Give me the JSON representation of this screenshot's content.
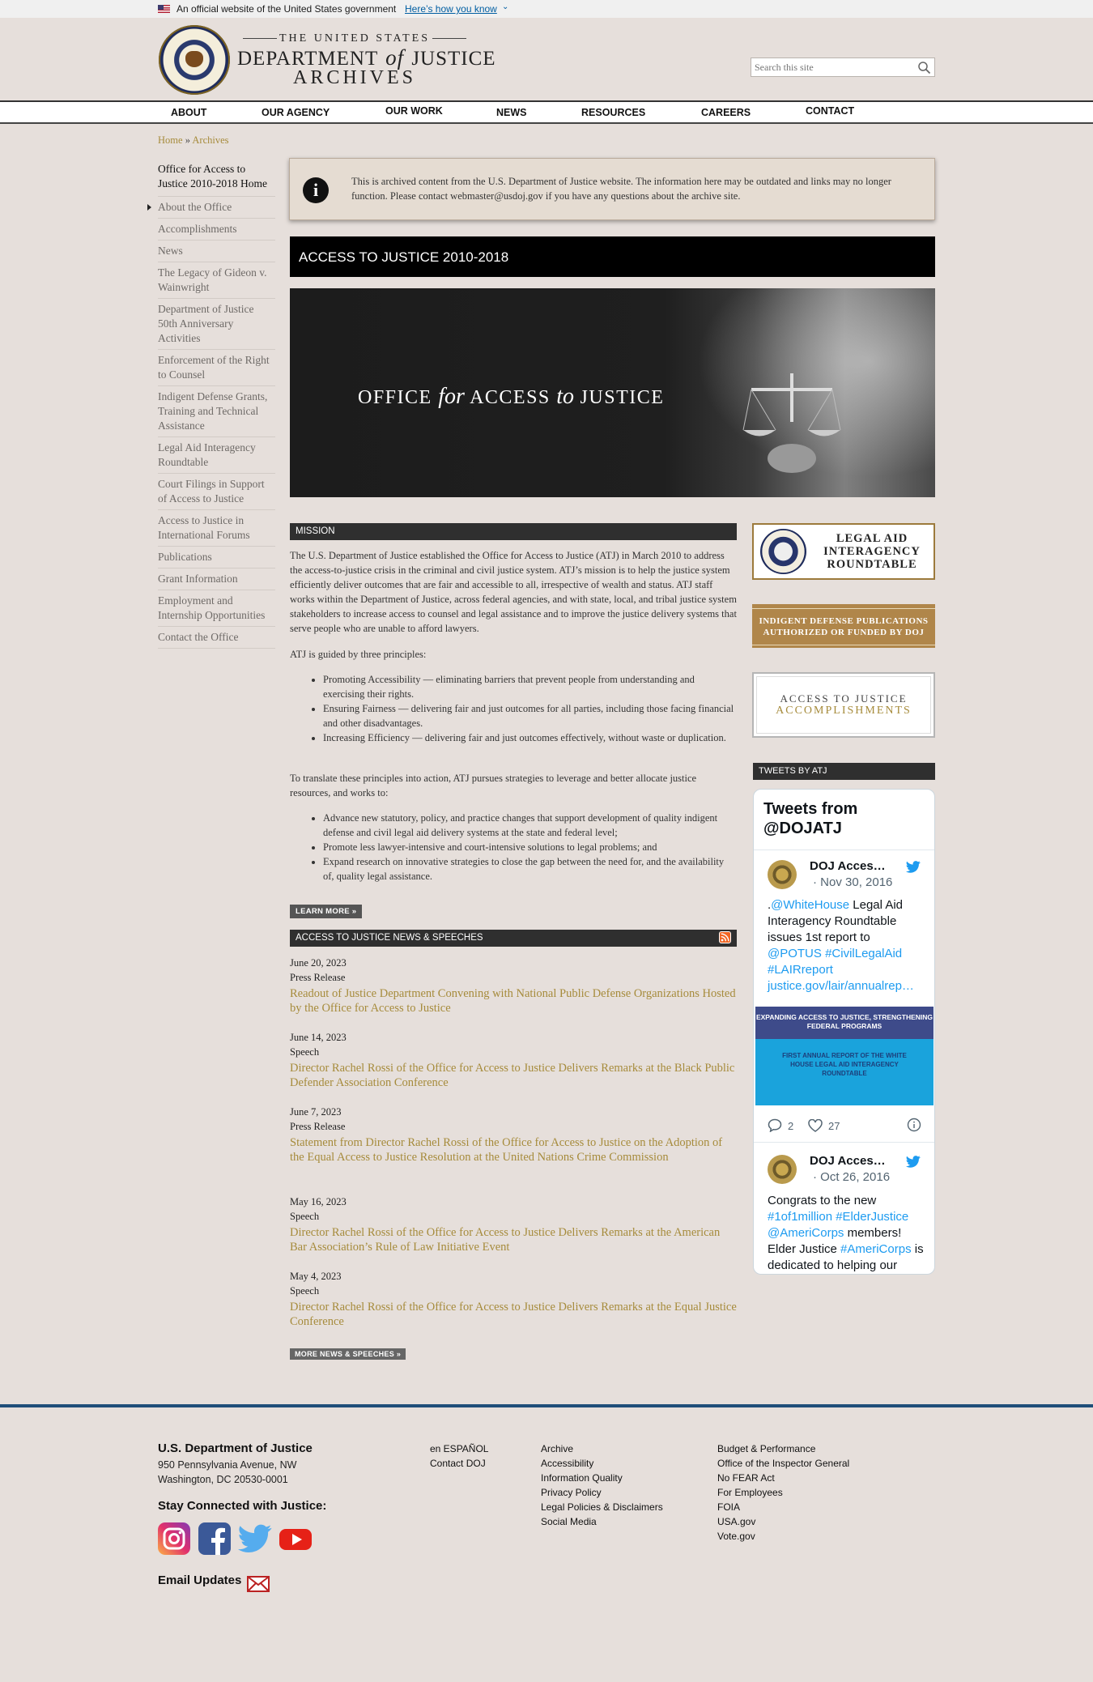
{
  "gov_banner": {
    "text": "An official website of the United States government",
    "link": "Here’s how you know"
  },
  "logo": {
    "top": "THE UNITED STATES",
    "mid_a": "DEPARTMENT",
    "mid_of": "of",
    "mid_b": "JUSTICE",
    "bottom": "ARCHIVES"
  },
  "search": {
    "placeholder": "Search this site"
  },
  "nav": [
    "ABOUT",
    "OUR AGENCY",
    "OUR WORK",
    "NEWS",
    "RESOURCES",
    "CAREERS",
    "CONTACT"
  ],
  "breadcrumb": {
    "home": "Home",
    "sep": "»",
    "current": "Archives"
  },
  "sidebar": {
    "home": "Office for Access to Justice 2010-2018 Home",
    "items": [
      "About the Office",
      "Accomplishments",
      "News",
      "The Legacy of Gideon v. Wainwright",
      "Department of Justice 50th Anniversary Activities",
      "Enforcement of the Right to Counsel",
      "Indigent Defense Grants, Training and Technical Assistance",
      "Legal Aid Interagency Roundtable",
      "Court Filings in Support of Access to Justice",
      "Access to Justice in International Forums",
      "Publications",
      "Grant Information",
      "Employment and Internship Opportunities",
      "Contact the Office"
    ]
  },
  "notice": {
    "text": "This is archived content from the U.S. Department of Justice website. The information here may be outdated and links may no longer function. Please contact webmaster@usdoj.gov if you have any questions about the archive site."
  },
  "page_title": "ACCESS TO JUSTICE 2010-2018",
  "hero": {
    "a": "OFFICE",
    "for": "for",
    "b": "ACCESS",
    "to": "to",
    "c": "JUSTICE"
  },
  "mission": {
    "heading": "MISSION",
    "p1": "The U.S. Department of Justice established the Office for Access to Justice (ATJ) in March 2010 to address the access-to-justice crisis in the criminal and civil justice system. ATJ’s mission is to help the justice system efficiently deliver outcomes that are fair and accessible to all, irrespective of wealth and status. ATJ staff works within the Department of Justice, across federal agencies, and with state, local, and tribal justice system stakeholders to increase access to counsel and legal assistance and to improve the justice delivery systems that serve people who are unable to afford lawyers.",
    "p2": "ATJ is guided by three principles:",
    "principles": [
      "Promoting Accessibility — eliminating barriers that prevent people from understanding and exercising their rights.",
      "Ensuring Fairness — delivering fair and just outcomes for all parties, including those facing financial and other disadvantages.",
      "Increasing Efficiency — delivering fair and just outcomes effectively, without waste or duplication."
    ],
    "p3": "To translate these principles into action, ATJ pursues strategies to leverage and better allocate justice resources, and works to:",
    "works": [
      "Advance new statutory, policy, and practice changes that support development of quality indigent defense and civil legal aid delivery systems at the state and federal level;",
      "Promote less lawyer-intensive and court-intensive solutions to legal problems; and",
      "Expand research on innovative strategies to close the gap between the need for, and the availability of, quality legal assistance."
    ],
    "learn_more": "LEARN MORE »"
  },
  "news": {
    "heading": "ACCESS TO JUSTICE NEWS & SPEECHES",
    "items": [
      {
        "date": "June 20, 2023",
        "type": "Press Release",
        "title": "Readout of Justice Department Convening with National Public Defense Organizations Hosted by the Office for Access to Justice"
      },
      {
        "date": "June 14, 2023",
        "type": "Speech",
        "title": "Director Rachel Rossi of the Office for Access to Justice Delivers Remarks at the Black Public Defender Association Conference"
      },
      {
        "date": "June 7, 2023",
        "type": "Press Release",
        "title": "Statement from Director Rachel Rossi of the Office for Access to Justice on the Adoption of the Equal Access to Justice Resolution at the United Nations Crime Commission"
      },
      {
        "date": "May 16, 2023",
        "type": "Speech",
        "title": "Director Rachel Rossi of the Office for Access to Justice Delivers Remarks at the American Bar Association’s Rule of Law Initiative Event"
      },
      {
        "date": "May 4, 2023",
        "type": "Speech",
        "title": "Director Rachel Rossi of the Office for Access to Justice Delivers Remarks at the Equal Justice Conference"
      }
    ],
    "more": "MORE NEWS & SPEECHES »"
  },
  "promos": {
    "lair": "LEGAL AID INTERAGENCY ROUNDTABLE",
    "indigent": "INDIGENT DEFENSE PUBLICATIONS AUTHORIZED OR FUNDED BY DOJ",
    "accomp_1": "ACCESS TO JUSTICE",
    "accomp_2": "ACCOMPLISHMENTS"
  },
  "tweets": {
    "heading": "TWEETS BY ATJ",
    "title": "Tweets from @DOJATJ",
    "items": [
      {
        "name": "DOJ Acces…",
        "date": "· Nov 30, 2016",
        "pre": ".",
        "l1": "@WhiteHouse",
        "t1": " Legal Aid Interagency Roundtable issues 1st report to ",
        "l2": "@POTUS #CivilLegalAid #LAIRreport justice.gov/lair/annualrep…",
        "media_top": "EXPANDING ACCESS TO JUSTICE, STRENGTHENING FEDERAL PROGRAMS",
        "media_sub": "FIRST ANNUAL REPORT OF THE WHITE HOUSE LEGAL AID INTERAGENCY ROUNDTABLE",
        "replies": "2",
        "likes": "27"
      },
      {
        "name": "DOJ Acces…",
        "date": "· Oct 26, 2016",
        "t1": "Congrats to the new ",
        "l1": "#1of1million #ElderJustice @AmeriCorps",
        "t2": " members! Elder Justice ",
        "l2": "#AmeriCorps",
        "t3": " is dedicated to helping our"
      }
    ]
  },
  "footer": {
    "org": "U.S. Department of Justice",
    "addr1": "950 Pennsylvania Avenue, NW",
    "addr2": "Washington, DC 20530-0001",
    "stay": "Stay Connected with Justice:",
    "email": "Email Updates",
    "col1": [
      "en ESPAÑOL",
      "Contact DOJ"
    ],
    "col2": [
      "Archive",
      "Accessibility",
      "Information Quality",
      "Privacy Policy",
      "Legal Policies & Disclaimers",
      "Social Media"
    ],
    "col3": [
      "Budget & Performance",
      "Office of the Inspector General",
      "No FEAR Act",
      "For Employees",
      "FOIA",
      "USA.gov",
      "Vote.gov"
    ]
  },
  "icons": [
    "flag-icon",
    "chevron-down-icon",
    "search-icon",
    "info-icon",
    "rss-icon",
    "twitter-bird-icon",
    "reply-icon",
    "heart-icon",
    "info-circle-icon",
    "instagram-icon",
    "facebook-icon",
    "twitter-icon",
    "youtube-icon",
    "envelope-icon"
  ],
  "colors": {
    "link_gold": "#a68b3b",
    "nav_border": "#333333",
    "footer_rule": "#1f4e79",
    "twitter_blue": "#1d9bf0"
  }
}
